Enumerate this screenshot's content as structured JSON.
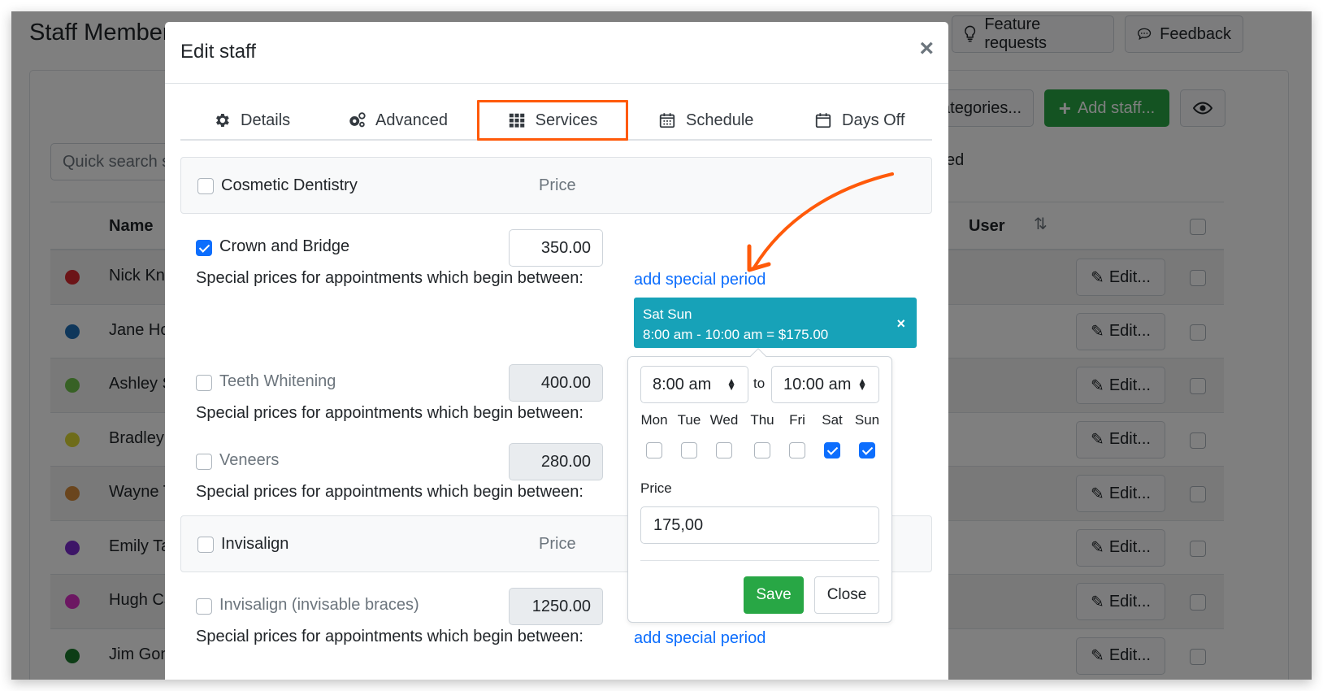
{
  "page": {
    "title": "Staff Members",
    "top_buttons": [
      {
        "label": "Feature requests",
        "icon": "lightbulb-icon"
      },
      {
        "label": "Feedback",
        "icon": "chat-icon"
      }
    ],
    "search_placeholder": "Quick search staff",
    "categories_label": "Categories...",
    "add_staff_label": "Add staff...",
    "visibility_icon": "eye-icon",
    "archived_fragment": "ed",
    "table": {
      "columns": [
        "Name",
        "User"
      ],
      "sort_icon": "sort-arrows-icon",
      "edit_label": "Edit...",
      "rows": [
        {
          "name": "Nick Kni",
          "color": "#d9282f"
        },
        {
          "name": "Jane Ho",
          "color": "#1f6eb6"
        },
        {
          "name": "Ashley S",
          "color": "#6fc34a"
        },
        {
          "name": "Bradley",
          "color": "#dcd834"
        },
        {
          "name": "Wayne T",
          "color": "#d48a3a"
        },
        {
          "name": "Emily Ta",
          "color": "#7a2bcf"
        },
        {
          "name": "Hugh Ca",
          "color": "#d92ec4"
        },
        {
          "name": "Jim Gon",
          "color": "#1a7a2c"
        }
      ]
    }
  },
  "modal": {
    "title": "Edit staff",
    "close_glyph": "×",
    "tabs": [
      {
        "label": "Details",
        "icon": "gear-icon",
        "active": false
      },
      {
        "label": "Advanced",
        "icon": "gears-icon",
        "active": false
      },
      {
        "label": "Services",
        "icon": "grid-icon",
        "active": true
      },
      {
        "label": "Schedule",
        "icon": "calendar-icon",
        "active": false
      },
      {
        "label": "Days Off",
        "icon": "calendar-blank-icon",
        "active": false
      }
    ],
    "price_header": "Price",
    "special_prices_text": "Special prices for appointments which begin between:",
    "add_special_period": "add special period",
    "groups": [
      {
        "name": "Cosmetic Dentistry",
        "checked": false,
        "services": [
          {
            "name": "Crown and Bridge",
            "checked": true,
            "price": "350.00"
          },
          {
            "name": "Teeth Whitening",
            "checked": false,
            "price": "400.00"
          },
          {
            "name": "Veneers",
            "checked": false,
            "price": "280.00"
          }
        ]
      },
      {
        "name": "Invisalign",
        "checked": false,
        "services": [
          {
            "name": "Invisalign (invisable braces)",
            "checked": false,
            "price": "1250.00"
          }
        ]
      }
    ],
    "special_period": {
      "days_summary": "Sat Sun",
      "range_summary": "8:00 am - 10:00 am = $175.00",
      "remove_glyph": "×",
      "color": "#17a2b8"
    },
    "period_editor": {
      "from": "8:00 am",
      "to_label": "to",
      "to": "10:00 am",
      "days": [
        {
          "label": "Mon",
          "checked": false
        },
        {
          "label": "Tue",
          "checked": false
        },
        {
          "label": "Wed",
          "checked": false
        },
        {
          "label": "Thu",
          "checked": false
        },
        {
          "label": "Fri",
          "checked": false
        },
        {
          "label": "Sat",
          "checked": true
        },
        {
          "label": "Sun",
          "checked": true
        }
      ],
      "price_label": "Price",
      "price_value": "175,00",
      "save_label": "Save",
      "close_label": "Close"
    },
    "annotation_color": "#ff5a0a"
  }
}
